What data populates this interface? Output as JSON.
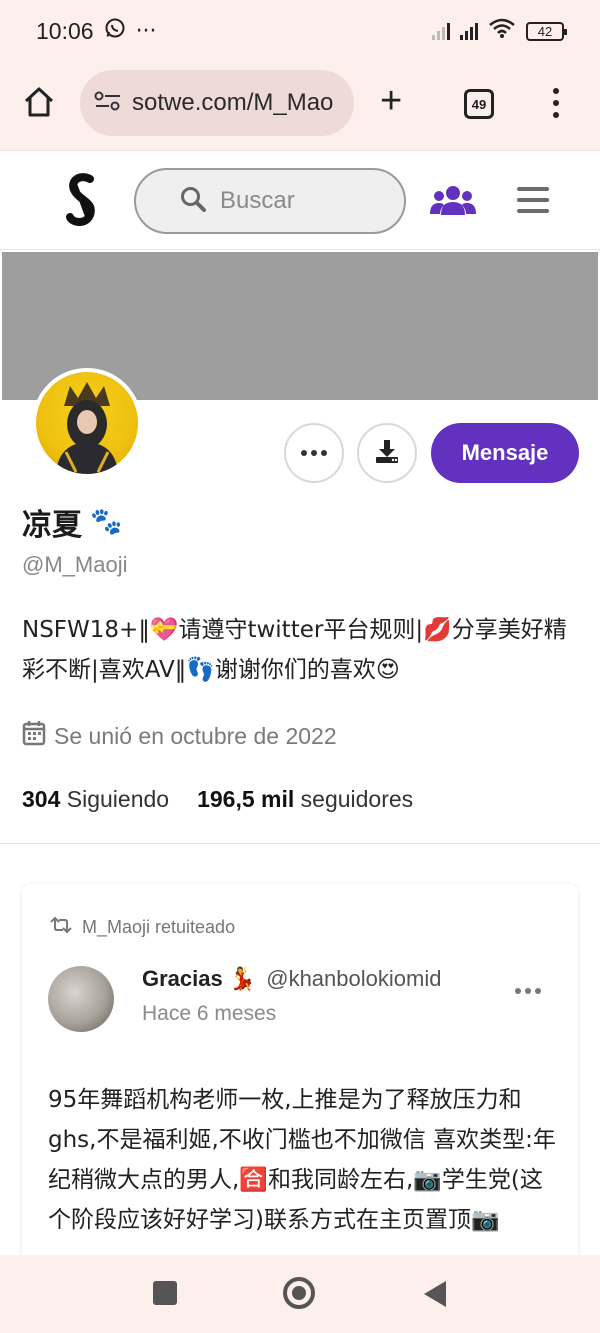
{
  "status_bar": {
    "time": "10:06",
    "whatsapp_icon": "whatsapp-icon",
    "more": "···",
    "battery": "42"
  },
  "browser": {
    "url": "sotwe.com/M_Mao",
    "tab_count": "49"
  },
  "site": {
    "search_placeholder": "Buscar"
  },
  "profile": {
    "name": "凉夏",
    "name_emoji": "🐾",
    "handle": "@M_Maoji",
    "message_button": "Mensaje",
    "bio": "NSFW18+‖💝请遵守twitter平台规则|💋分享美好精彩不断|喜欢AV‖👣谢谢你们的喜欢😍",
    "joined": "Se unió en octubre de 2022",
    "following_count": "304",
    "following_label": "Siguiendo",
    "followers_count": "196,5 mil",
    "followers_label": "seguidores"
  },
  "tweet": {
    "retweet_label": "M_Maoji retuiteado",
    "author_name": "Gracias 💃",
    "author_handle": "@khanbolokiomid",
    "time": "Hace 6 meses",
    "text": "95年舞蹈机构老师一枚,上推是为了释放压力和ghs,不是福利姬,不收门槛也不加微信 喜欢类型:年纪稍微大点的男人,🈴和我同龄左右,📷学生党(这个阶段应该好好学习)联系方式在主页置顶📷"
  },
  "colors": {
    "accent": "#6331c0",
    "chrome": "#fcefec",
    "banner": "#9e9e9e"
  }
}
